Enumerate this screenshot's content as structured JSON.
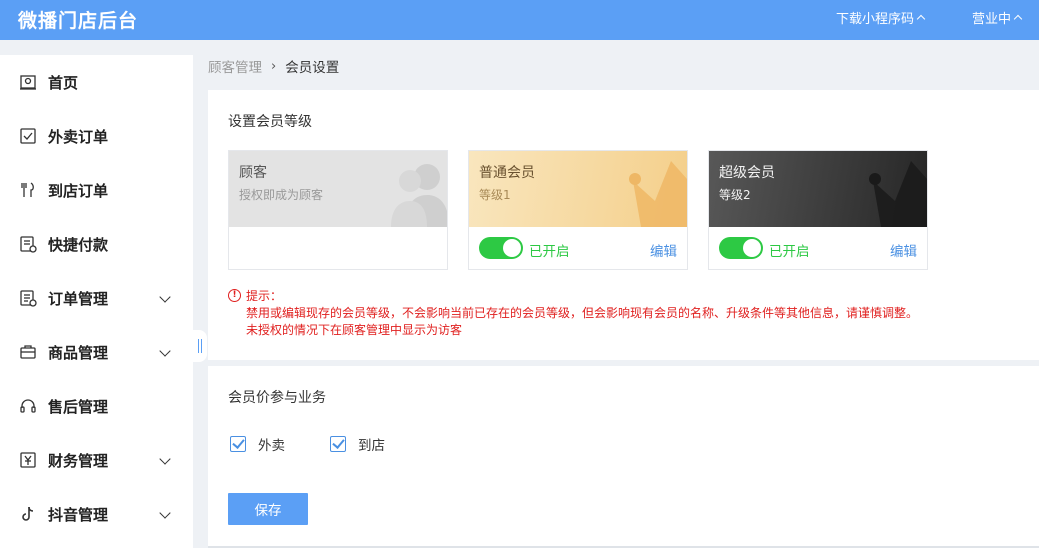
{
  "header": {
    "app_title": "微播门店后台",
    "download_label": "下载小程序码",
    "status_label": "营业中"
  },
  "colors": {
    "header_bg": "#5b9ff5",
    "accent": "#4a90e2",
    "toggle_on": "#2dc944",
    "warning": "#e0201f"
  },
  "sidebar": {
    "items": [
      {
        "label": "首页",
        "icon": "home-icon",
        "expandable": false
      },
      {
        "label": "外卖订单",
        "icon": "delivery-order-icon",
        "expandable": false
      },
      {
        "label": "到店订单",
        "icon": "dining-icon",
        "expandable": false
      },
      {
        "label": "快捷付款",
        "icon": "quick-pay-icon",
        "expandable": false
      },
      {
        "label": "订单管理",
        "icon": "order-list-icon",
        "expandable": true
      },
      {
        "label": "商品管理",
        "icon": "briefcase-icon",
        "expandable": true
      },
      {
        "label": "售后管理",
        "icon": "headset-icon",
        "expandable": false
      },
      {
        "label": "财务管理",
        "icon": "yuan-icon",
        "expandable": true
      },
      {
        "label": "抖音管理",
        "icon": "tiktok-icon",
        "expandable": true
      }
    ]
  },
  "breadcrumb": {
    "parent": "顾客管理",
    "separator": "›",
    "current": "会员设置"
  },
  "levels_section": {
    "title": "设置会员等级",
    "cards": [
      {
        "name": "顾客",
        "subtitle": "授权即成为顾客",
        "decoration": "users-icon"
      },
      {
        "name": "普通会员",
        "subtitle": "等级1",
        "decoration": "crown-icon",
        "enabled": true,
        "status_label": "已开启",
        "edit_label": "编辑"
      },
      {
        "name": "超级会员",
        "subtitle": "等级2",
        "decoration": "crown-icon",
        "enabled": true,
        "status_label": "已开启",
        "edit_label": "编辑"
      }
    ],
    "notice": {
      "icon": "!",
      "title": "提示：",
      "lines": [
        "禁用或编辑现存的会员等级，不会影响当前已存在的会员等级，但会影响现有会员的名称、升级条件等其他信息，请谨慎调整。",
        "未授权的情况下在顾客管理中显示为访客"
      ]
    }
  },
  "business_section": {
    "title": "会员价参与业务",
    "options": [
      {
        "label": "外卖",
        "checked": true
      },
      {
        "label": "到店",
        "checked": true
      }
    ],
    "save_label": "保存"
  }
}
